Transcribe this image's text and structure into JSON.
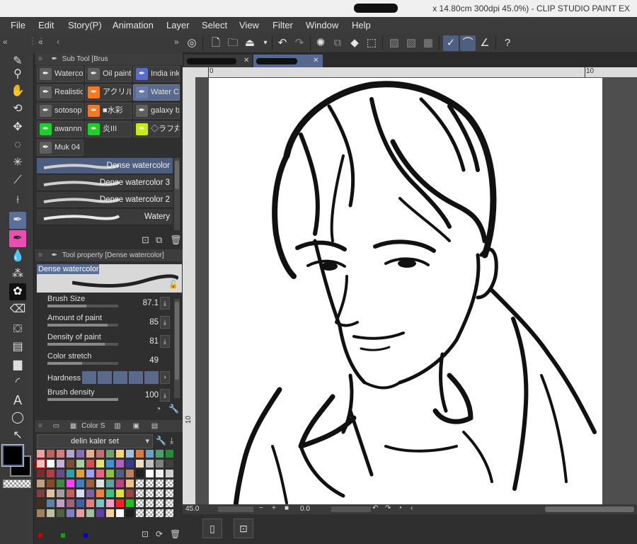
{
  "window": {
    "title_visible": "x 14.80cm 300dpi 45.0%) - CLIP STUDIO PAINT EX"
  },
  "menu": [
    "File",
    "Edit",
    "Story(P)",
    "Animation",
    "Layer",
    "Select",
    "View",
    "Filter",
    "Window",
    "Help"
  ],
  "subtool_panel": {
    "header": "Sub Tool [Brus",
    "chips": [
      {
        "label": "Waterco",
        "icon_color": "#5f5f5f",
        "selected": false
      },
      {
        "label": "Oil paint",
        "icon_color": "#5f5f5f",
        "selected": false
      },
      {
        "label": "India ink",
        "icon_color": "#5b6cc4",
        "selected": false
      },
      {
        "label": "Realistic",
        "icon_color": "#5f5f5f",
        "selected": false
      },
      {
        "label": "アクリル",
        "icon_color": "#f07a2a",
        "selected": false
      },
      {
        "label": "Water C",
        "icon_color": "#6a7ba8",
        "selected": true
      },
      {
        "label": "sotosop",
        "icon_color": "#5f5f5f",
        "selected": false
      },
      {
        "label": "■水彩",
        "icon_color": "#f07a2a",
        "selected": false
      },
      {
        "label": "galaxy b",
        "icon_color": "#5f5f5f",
        "selected": false
      },
      {
        "label": "awannn",
        "icon_color": "#1ecf2a",
        "selected": false
      },
      {
        "label": "炎III",
        "icon_color": "#1ecf2a",
        "selected": false
      },
      {
        "label": "◇ラフ丸",
        "icon_color": "#c8ea1a",
        "selected": false
      },
      {
        "label": "Muk 04",
        "icon_color": "#5f5f5f",
        "selected": false
      }
    ],
    "brushes": [
      {
        "name": "Dense watercolor",
        "selected": true
      },
      {
        "name": "Dense watercolor 3",
        "selected": false
      },
      {
        "name": "Dense watercolor 2",
        "selected": false
      },
      {
        "name": "Watery",
        "selected": false
      }
    ]
  },
  "tool_property": {
    "header": "Tool property [Dense watercolor]",
    "preview_name": "Dense watercolor",
    "properties": [
      {
        "label": "Brush Size",
        "value": "87.1",
        "fill": 0.55
      },
      {
        "label": "Amount of paint",
        "value": "85",
        "fill": 0.85
      },
      {
        "label": "Density of paint",
        "value": "81",
        "fill": 0.81
      },
      {
        "label": "Color stretch",
        "value": "49",
        "fill": 0.49
      }
    ],
    "hardness_label": "Hardness",
    "brush_density_label": "Brush density",
    "brush_density_value": "100"
  },
  "color_panel": {
    "header": "Color S",
    "set_name": "delin kaler set"
  },
  "document": {
    "ruler_top_left": "0",
    "ruler_top_right": "10",
    "ruler_left": "10",
    "zoom": "45.0",
    "angle": "0.0"
  },
  "colors": {
    "accent": "#5a6f99",
    "panel_bg": "#2f2f2f",
    "foreground": "#000000"
  }
}
